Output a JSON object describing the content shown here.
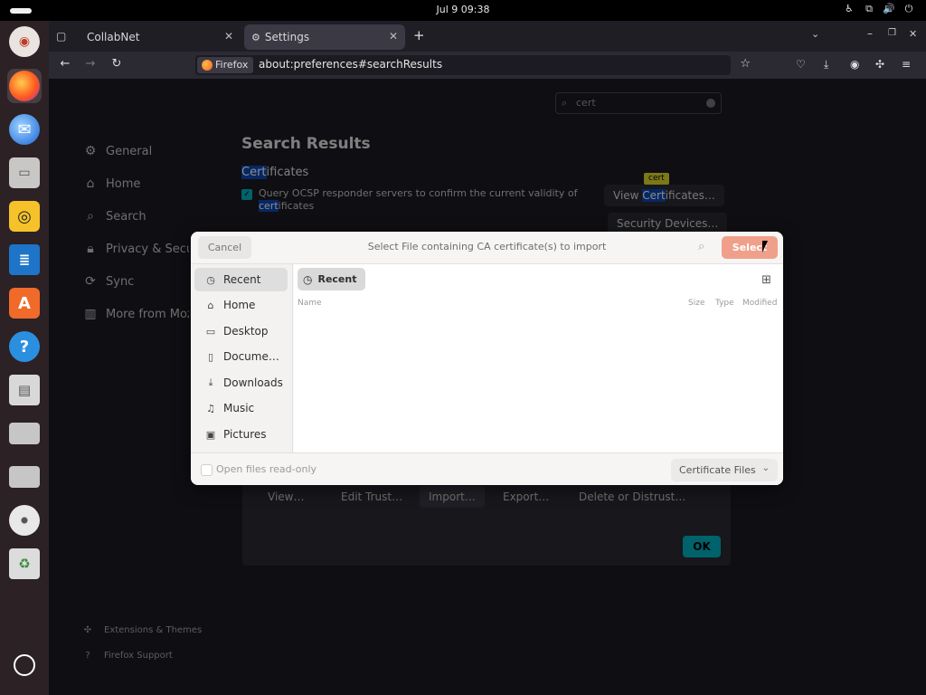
{
  "topbar": {
    "datetime": "Jul 9  09:38"
  },
  "dock": {
    "apps": [
      "Ubuntu Installer",
      "Firefox",
      "Thunderbird",
      "Files",
      "Rhythmbox",
      "LibreOffice Writer",
      "App Center",
      "Help",
      "Save",
      "Drive",
      "Drive",
      "Disc",
      "Trash"
    ]
  },
  "browser": {
    "tabs": [
      {
        "label": "CollabNet",
        "active": false
      },
      {
        "label": "Settings",
        "active": true
      }
    ],
    "urlbar": {
      "identity": "Firefox",
      "url": "about:preferences#searchResults"
    }
  },
  "prefs": {
    "search_value": "cert",
    "nav": [
      {
        "label": "General",
        "icon": "gear-icon"
      },
      {
        "label": "Home",
        "icon": "home-icon"
      },
      {
        "label": "Search",
        "icon": "search-icon"
      },
      {
        "label": "Privacy & Security",
        "icon": "lock-icon"
      },
      {
        "label": "Sync",
        "icon": "sync-icon"
      },
      {
        "label": "More from Mozilla",
        "icon": "mozilla-icon"
      }
    ],
    "footer": {
      "extensions": "Extensions & Themes",
      "support": "Firefox Support"
    },
    "results_title": "Search Results",
    "certificates_heading": {
      "match": "Cert",
      "rest": "ificates"
    },
    "ocsp": {
      "prefix": "Query OCSP responder servers to confirm the current validity of ",
      "match": "cert",
      "rest": "ificates",
      "checked": true
    },
    "view_certs": {
      "before": "View ",
      "match": "Cert",
      "rest": "ificates…"
    },
    "security_devices": "Security Devices…",
    "tooltip": "cert"
  },
  "cert_manager": {
    "buttons": [
      "View…",
      "Edit Trust…",
      "Import…",
      "Export…",
      "Delete or Distrust…"
    ],
    "ok": "OK"
  },
  "file_chooser": {
    "cancel": "Cancel",
    "title": "Select File containing CA certificate(s) to import",
    "select": "Select",
    "places": [
      {
        "label": "Recent",
        "icon": "clock-icon",
        "selected": true
      },
      {
        "label": "Home",
        "icon": "home-icon",
        "selected": false
      },
      {
        "label": "Desktop",
        "icon": "desktop-icon",
        "selected": false
      },
      {
        "label": "Docume…",
        "icon": "document-icon",
        "selected": false
      },
      {
        "label": "Downloads",
        "icon": "download-icon",
        "selected": false
      },
      {
        "label": "Music",
        "icon": "music-icon",
        "selected": false
      },
      {
        "label": "Pictures",
        "icon": "picture-icon",
        "selected": false
      }
    ],
    "crumb": "Recent",
    "columns": {
      "name": "Name",
      "size": "Size",
      "type": "Type",
      "modified": "Modified"
    },
    "read_only_label": "Open files read-only",
    "filter": "Certificate Files"
  }
}
